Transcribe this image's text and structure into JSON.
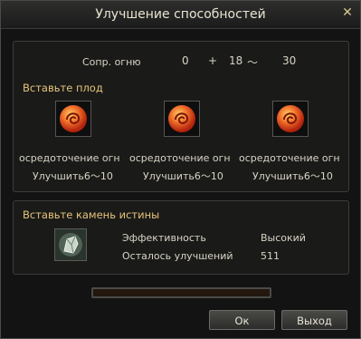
{
  "window": {
    "title": "Улучшение способностей"
  },
  "resistance": {
    "label": "Сопр. огню",
    "base": "0",
    "plus": "+",
    "min": "18",
    "tilde": "～",
    "max": "30"
  },
  "fruit_section": {
    "title": "Вставьте плод",
    "slots": [
      {
        "name": "осредоточение огн",
        "range": "Улучшить6～10"
      },
      {
        "name": "осредоточение огн",
        "range": "Улучшить6～10"
      },
      {
        "name": "осредоточение огн",
        "range": "Улучшить6～10"
      }
    ]
  },
  "stone_section": {
    "title": "Вставьте камень истины",
    "efficiency_label": "Эффективность",
    "efficiency_value": "Высокий",
    "remaining_label": "Осталось улучшений",
    "remaining_value": "511"
  },
  "progress": {
    "value": 0
  },
  "buttons": {
    "ok": "Ок",
    "exit": "Выход"
  },
  "icons": {
    "fruit": "fire-fruit-icon",
    "stone": "truth-stone-icon",
    "close": "close-icon"
  },
  "colors": {
    "accent": "#e7c47a",
    "fruit_red": "#d9441c",
    "fruit_orange": "#f39a2a"
  }
}
